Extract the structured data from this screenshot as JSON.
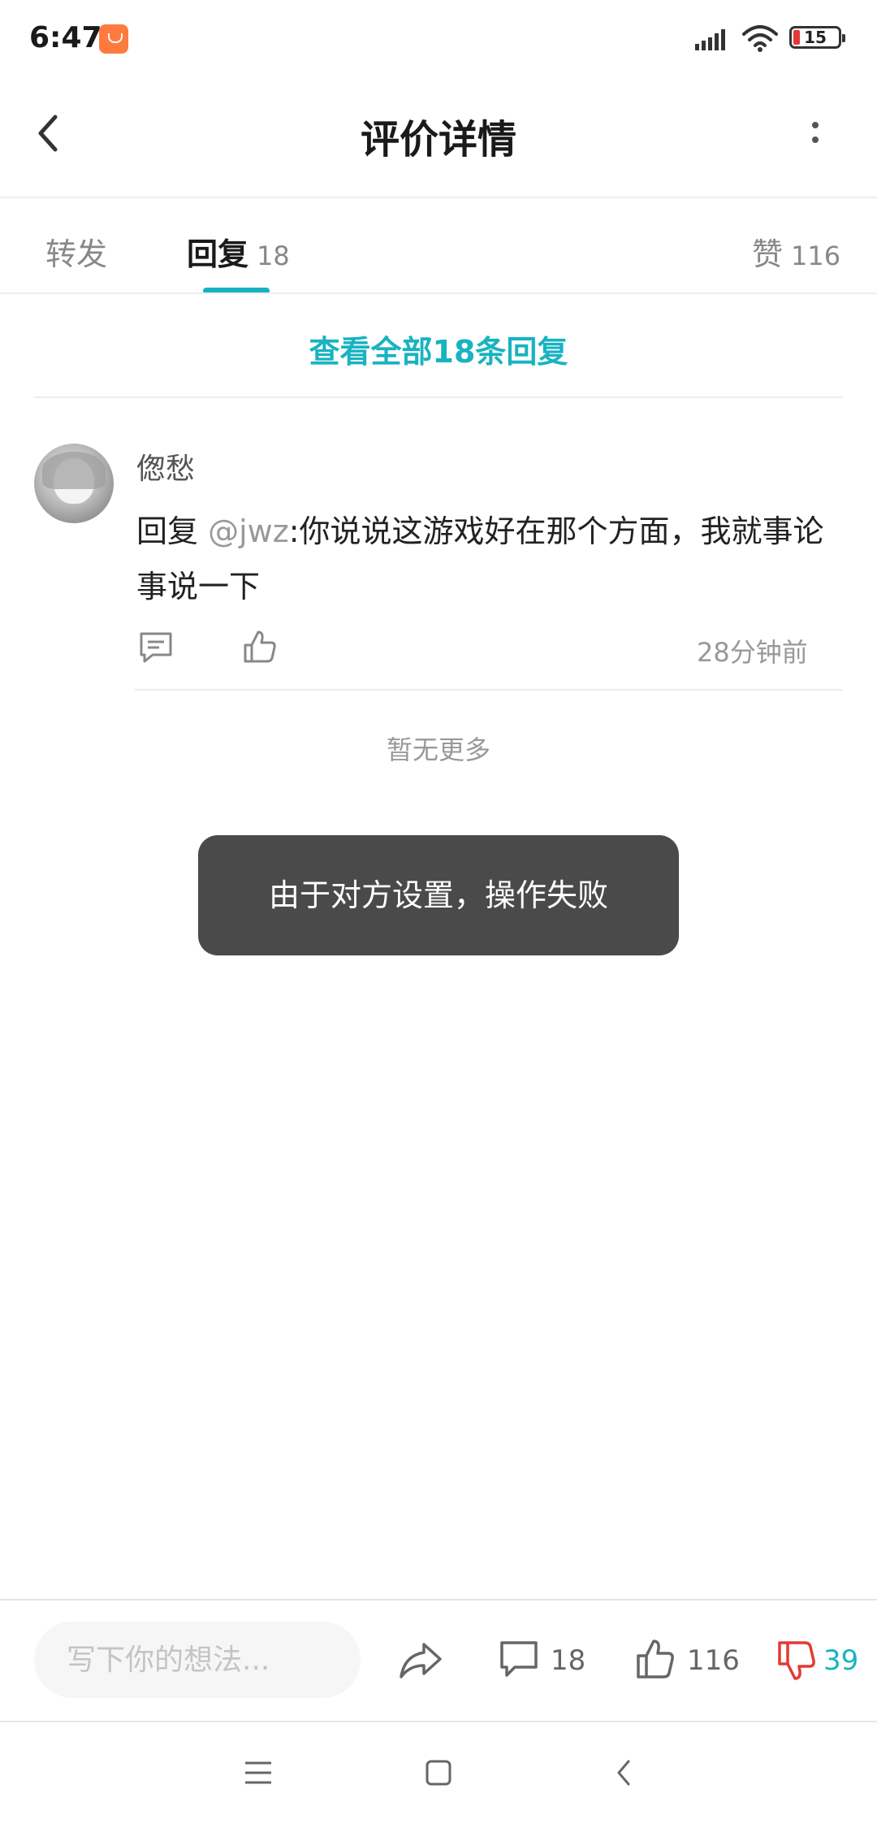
{
  "status_bar": {
    "time": "6:47",
    "battery_level": "15",
    "icons": [
      "app-notification-icon",
      "signal-icon",
      "wifi-icon",
      "battery-icon"
    ]
  },
  "header": {
    "title": "评价详情",
    "back_icon": "back-arrow-icon",
    "more_icon": "more-vertical-icon"
  },
  "tabs": [
    {
      "label": "转发",
      "count": ""
    },
    {
      "label": "回复",
      "count": "18",
      "active": true
    },
    {
      "label": "赞",
      "count": "116"
    }
  ],
  "view_all_label": "查看全部18条回复",
  "reply": {
    "username": "偬愁",
    "prefix": "回复 ",
    "mention": "@jwz",
    "text": ":你说说这游戏好在那个方面，我就事论事说一下",
    "time_ago": "28分钟前"
  },
  "no_more_label": "暂无更多",
  "toast": "由于对方设置，操作失败",
  "bottom_bar": {
    "input_placeholder": "写下你的想法...",
    "comment_count": "18",
    "like_count": "116",
    "dislike_count": "39"
  },
  "colors": {
    "accent": "#18b3c0",
    "dislike": "#e53935",
    "toast_bg": "#4a4a4a",
    "app_badge": "#ff7a3d"
  }
}
